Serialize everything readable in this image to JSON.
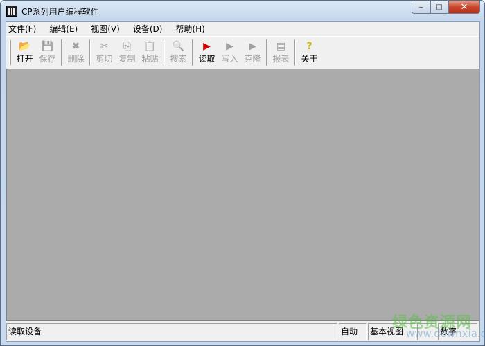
{
  "window": {
    "title": "CP系列用户编程软件",
    "minimize": "‒",
    "maximize": "□",
    "close": "✕"
  },
  "menu": [
    {
      "label": "文件(F)"
    },
    {
      "label": "编辑(E)"
    },
    {
      "label": "视图(V)"
    },
    {
      "label": "设备(D)"
    },
    {
      "label": "帮助(H)"
    }
  ],
  "toolbar": [
    {
      "label": "打开",
      "icon": "📂",
      "enabled": true
    },
    {
      "label": "保存",
      "icon": "💾",
      "enabled": false
    },
    {
      "label": "删除",
      "icon": "✖",
      "enabled": false
    },
    {
      "label": "剪切",
      "icon": "✂",
      "enabled": false
    },
    {
      "label": "复制",
      "icon": "⎘",
      "enabled": false
    },
    {
      "label": "粘贴",
      "icon": "📋",
      "enabled": false
    },
    {
      "label": "搜索",
      "icon": "🔍",
      "enabled": false
    },
    {
      "label": "读取",
      "icon": "▶",
      "enabled": true
    },
    {
      "label": "写入",
      "icon": "▶",
      "enabled": false
    },
    {
      "label": "克隆",
      "icon": "▶",
      "enabled": false
    },
    {
      "label": "报表",
      "icon": "▤",
      "enabled": false
    },
    {
      "label": "关于",
      "icon": "?",
      "enabled": true
    }
  ],
  "status": {
    "message": "读取设备",
    "mode": "自动",
    "view": "基本视图",
    "empty1": "",
    "numlock": "数字",
    "empty2": ""
  },
  "watermark": {
    "name": "绿色资源网",
    "url": "www.downxia.com"
  }
}
